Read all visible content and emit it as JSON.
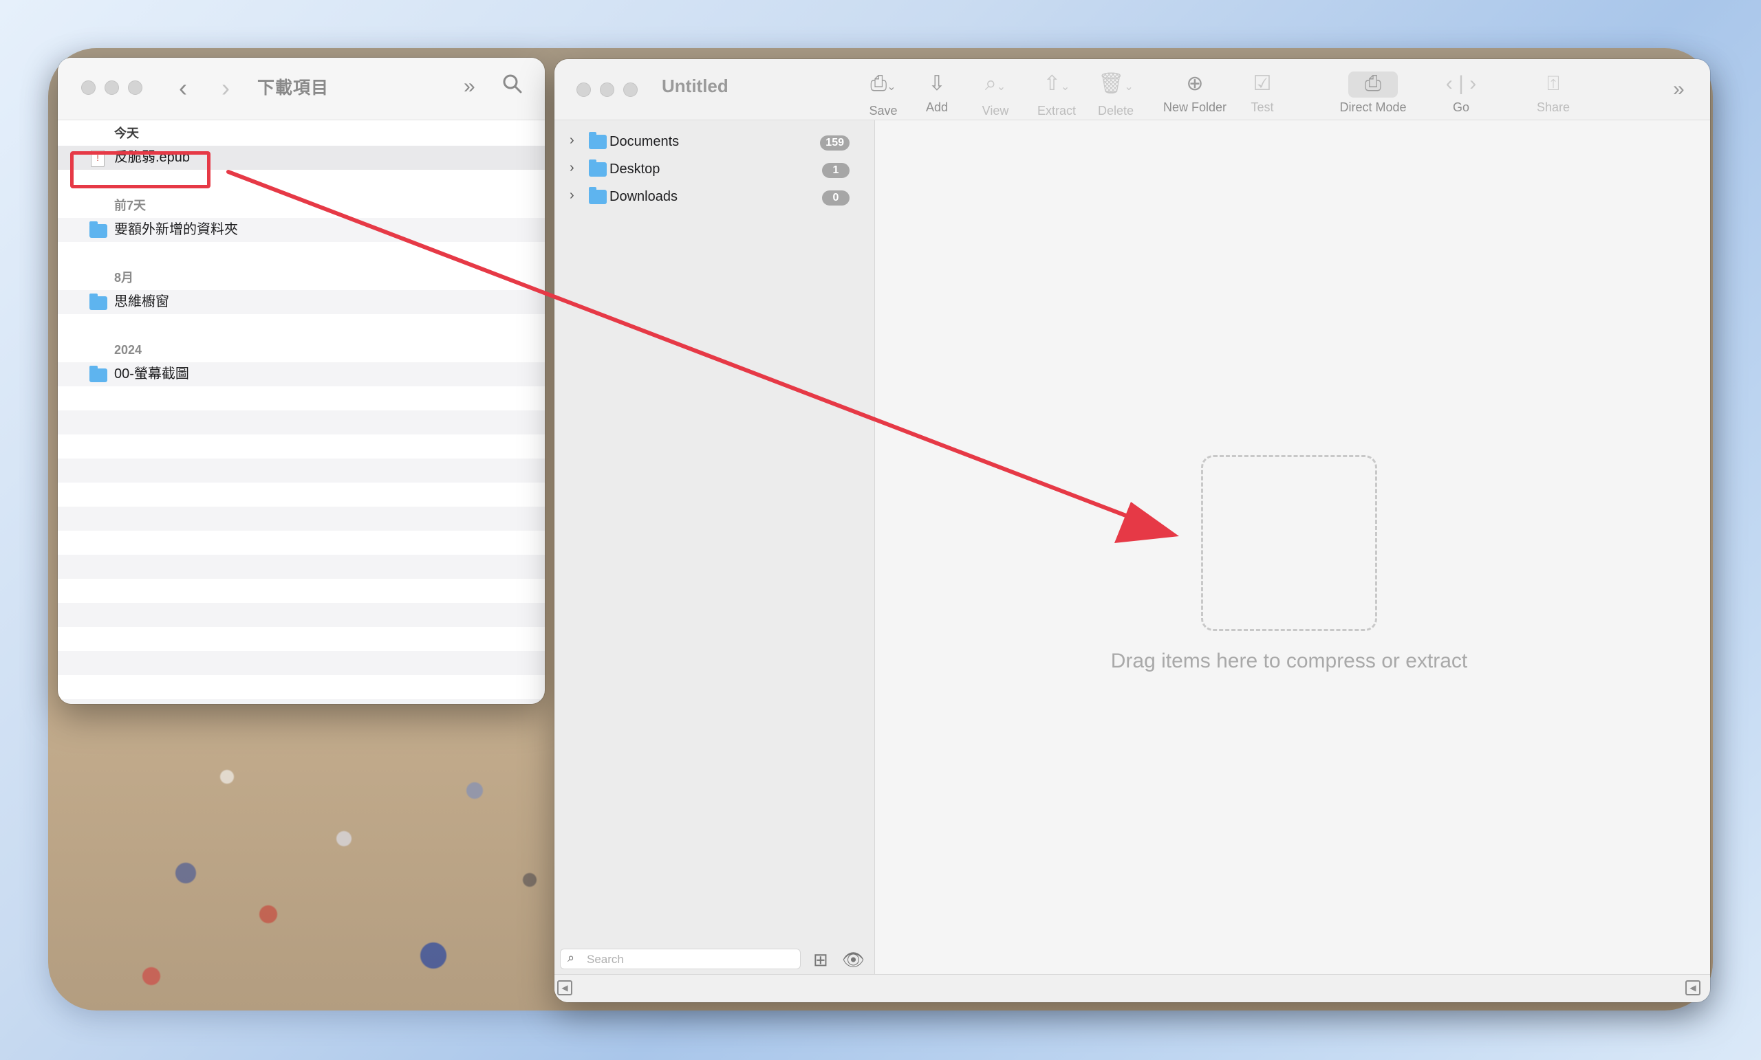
{
  "finder": {
    "title": "下載項目",
    "sections": {
      "today": "今天",
      "last7": "前7天",
      "august": "8月",
      "y2024": "2024"
    },
    "items": {
      "epub": "反脆弱.epub",
      "extra_folder": "要額外新增的資料夾",
      "mind_folder": "思維櫥窗",
      "screenshots_folder": "00-螢幕截圖"
    }
  },
  "archiver": {
    "title": "Untitled",
    "toolbar": {
      "save": "Save",
      "add": "Add",
      "view": "View",
      "extract": "Extract",
      "delete": "Delete",
      "new_folder": "New Folder",
      "test": "Test",
      "direct_mode": "Direct Mode",
      "go": "Go",
      "share": "Share"
    },
    "sidebar": [
      {
        "label": "Documents",
        "count": "159"
      },
      {
        "label": "Desktop",
        "count": "1"
      },
      {
        "label": "Downloads",
        "count": "0"
      }
    ],
    "search_placeholder": "Search",
    "drop_text": "Drag items here to compress or extract"
  },
  "colors": {
    "annotation_red": "#e63946",
    "folder_blue": "#5eb4ef"
  }
}
